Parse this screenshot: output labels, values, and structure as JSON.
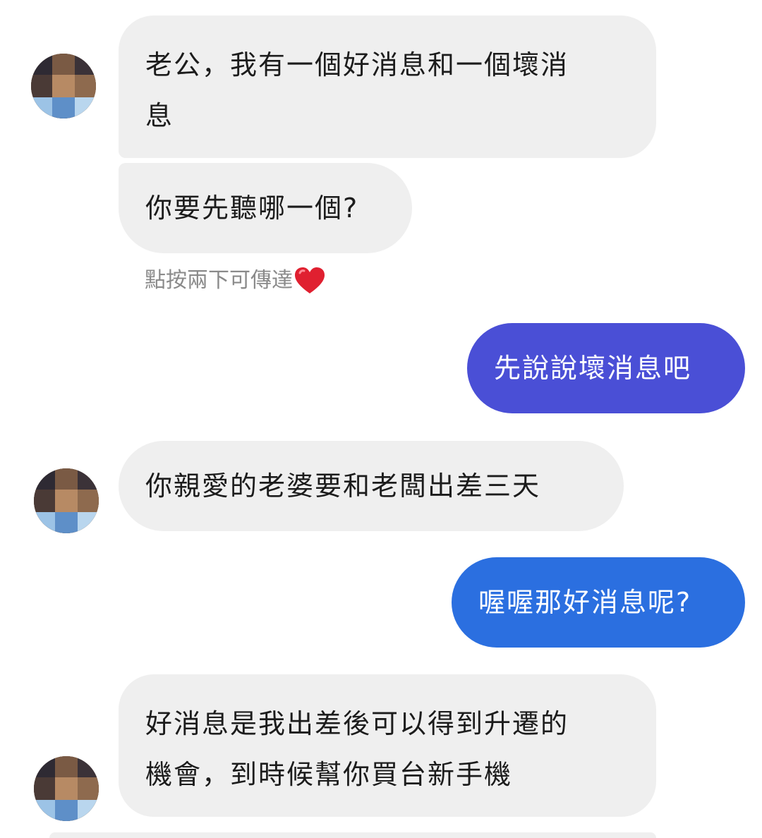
{
  "conversation": {
    "messages": [
      {
        "id": "m1",
        "direction": "incoming",
        "lines": [
          "老公，我有一個好消息和一個壞消",
          "息"
        ]
      },
      {
        "id": "m2",
        "direction": "incoming",
        "lines": [
          "你要先聽哪一個?"
        ]
      },
      {
        "id": "m3",
        "direction": "outgoing",
        "lines": [
          "先說說壞消息吧"
        ]
      },
      {
        "id": "m4",
        "direction": "incoming",
        "lines": [
          "你親愛的老婆要和老闆出差三天"
        ]
      },
      {
        "id": "m5",
        "direction": "outgoing",
        "lines": [
          "喔喔那好消息呢?"
        ]
      },
      {
        "id": "m6",
        "direction": "incoming",
        "lines": [
          "好消息是我出差後可以得到升遷的",
          "機會，到時候幫你買台新手機"
        ]
      }
    ],
    "reaction_hint": {
      "text": "點按兩下可傳達",
      "icon": "heart-icon"
    }
  },
  "colors": {
    "incoming_bubble": "#efefef",
    "outgoing_bubble_1": "#4a4fd6",
    "outgoing_bubble_2": "#2b6fe0",
    "hint_text": "#8a8a8a",
    "heart": "#e02030"
  }
}
